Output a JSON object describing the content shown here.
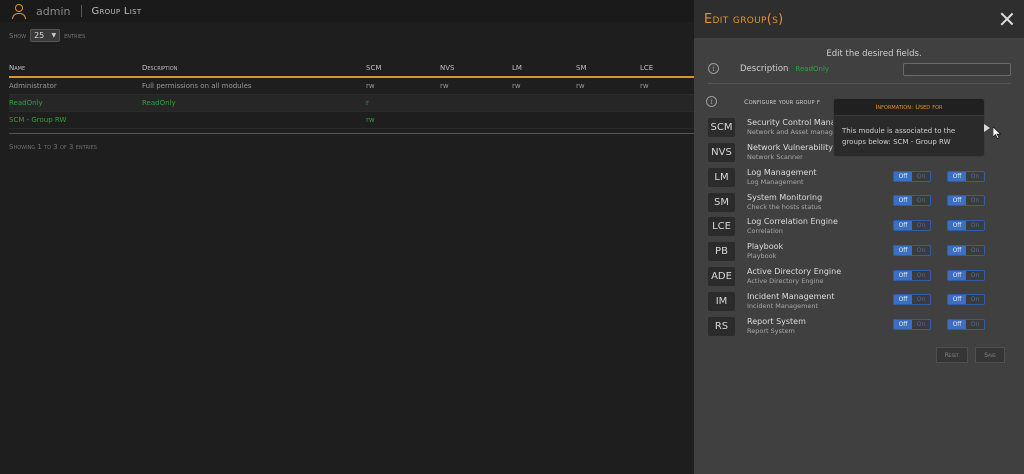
{
  "topbar": {
    "username": "admin",
    "title": "Group List"
  },
  "list": {
    "show_label": "Show",
    "entries_label": "entries",
    "page_size": "25",
    "columns": [
      "Name",
      "Description",
      "SCM",
      "NVS",
      "LM",
      "SM",
      "LCE"
    ],
    "rows": [
      {
        "name": "Administrator",
        "description": "Full permissions on all modules",
        "scm": "rw",
        "nvs": "rw",
        "lm": "rw",
        "sm": "rw",
        "lce": "rw"
      },
      {
        "name": "ReadOnly",
        "description": "ReadOnly",
        "scm": "r",
        "nvs": "",
        "lm": "",
        "sm": "",
        "lce": ""
      },
      {
        "name": "SCM - Group RW",
        "description": "",
        "scm": "rw",
        "nvs": "",
        "lm": "",
        "sm": "",
        "lce": ""
      }
    ],
    "footer": "Showing 1 to 3 of 3 entries"
  },
  "panel": {
    "title": "Edit group(s)",
    "hint": "Edit the desired fields.",
    "description_label": "Description",
    "description_value": "ReadOnly",
    "configure_label": "Configure your group f",
    "modules": [
      {
        "code": "SCM",
        "name": "Security Control Management",
        "sub": "Network and Asset management"
      },
      {
        "code": "NVS",
        "name": "Network Vulnerability Scanner",
        "sub": "Network Scanner"
      },
      {
        "code": "LM",
        "name": "Log Management",
        "sub": "Log Management"
      },
      {
        "code": "SM",
        "name": "System Monitoring",
        "sub": "Check the hosts status"
      },
      {
        "code": "LCE",
        "name": "Log Correlation Engine",
        "sub": "Correlation"
      },
      {
        "code": "PB",
        "name": "Playbook",
        "sub": "Playbook"
      },
      {
        "code": "ADE",
        "name": "Active Directory Engine",
        "sub": "Active Directory Engine"
      },
      {
        "code": "IM",
        "name": "Incident Management",
        "sub": "Incident Management"
      },
      {
        "code": "RS",
        "name": "Report System",
        "sub": "Report System"
      }
    ],
    "toggle_off": "Off",
    "toggle_on": "On",
    "reset_label": "Reset",
    "save_label": "Save"
  },
  "tooltip": {
    "title": "Information: Used for",
    "body": "This module is associated to the groups below: SCM - Group RW"
  },
  "colors": {
    "accent": "#e0922b",
    "toggle_blue": "#3a6fc4",
    "green_text": "#2fa23a"
  }
}
